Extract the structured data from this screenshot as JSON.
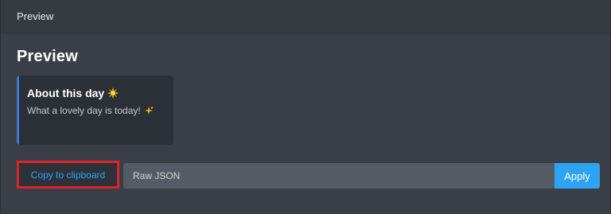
{
  "header": {
    "title": "Preview"
  },
  "main": {
    "heading": "Preview"
  },
  "embed": {
    "title": "About this day",
    "title_emoji": "sun-icon",
    "description": "What a lovely day is today!",
    "description_emoji": "sparkles-icon",
    "accent_color": "#3b78d8"
  },
  "actions": {
    "copy_label": "Copy to clipboard",
    "json_placeholder": "Raw JSON",
    "apply_label": "Apply"
  },
  "colors": {
    "background": "#3a3f47",
    "link": "#2ea3f2",
    "highlight": "#e0202a",
    "apply": "#2ea3f2"
  }
}
